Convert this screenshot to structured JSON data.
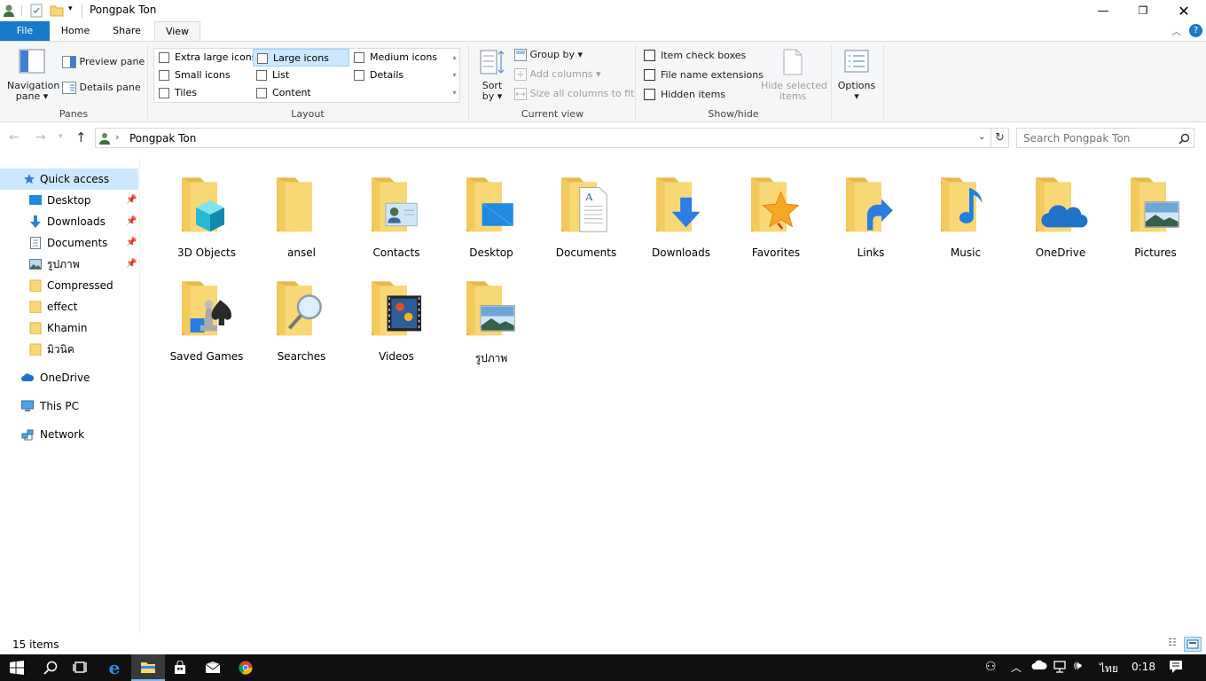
{
  "window": {
    "title": "Pongpak Ton"
  },
  "tabs": [
    "File",
    "Home",
    "Share",
    "View"
  ],
  "ribbon": {
    "panes": {
      "navigation_pane": "Navigation",
      "navigation_pane2": "pane",
      "preview_pane": "Preview pane",
      "details_pane": "Details pane",
      "label": "Panes"
    },
    "layout": {
      "items": [
        "Extra large icons",
        "Large icons",
        "Medium icons",
        "Small icons",
        "List",
        "Details",
        "Tiles",
        "Content"
      ],
      "selected": "Large icons",
      "label": "Layout"
    },
    "current_view": {
      "sort_by": "Sort",
      "sort_by2": "by",
      "group_by": "Group by",
      "add_columns": "Add columns",
      "size_columns": "Size all columns to fit",
      "label": "Current view"
    },
    "show_hide": {
      "item_check_boxes": "Item check boxes",
      "file_name_extensions": "File name extensions",
      "hidden_items": "Hidden items",
      "hide_selected": "Hide selected",
      "hide_selected2": "items",
      "label": "Show/hide"
    },
    "options": {
      "label": "Options"
    }
  },
  "address": {
    "path": "Pongpak Ton",
    "search_placeholder": "Search Pongpak Ton"
  },
  "nav": {
    "quick_access": "Quick access",
    "pinned": [
      "Desktop",
      "Downloads",
      "Documents",
      "รูปภาพ"
    ],
    "recent": [
      "Compressed",
      "effect",
      "Khamin",
      "มิวนิค"
    ],
    "onedrive": "OneDrive",
    "this_pc": "This PC",
    "network": "Network"
  },
  "items": [
    "3D Objects",
    "ansel",
    "Contacts",
    "Desktop",
    "Documents",
    "Downloads",
    "Favorites",
    "Links",
    "Music",
    "OneDrive",
    "Pictures",
    "Saved Games",
    "Searches",
    "Videos",
    "รูปภาพ"
  ],
  "status": {
    "count": "15 items"
  },
  "taskbar": {
    "lang": "ไทย",
    "time": "0:18"
  },
  "colors": {
    "accent": "#1979ca",
    "folder": "#f8d775",
    "folder_dark": "#e8b84a",
    "selected": "#cce8ff",
    "taskbar": "#101010"
  }
}
